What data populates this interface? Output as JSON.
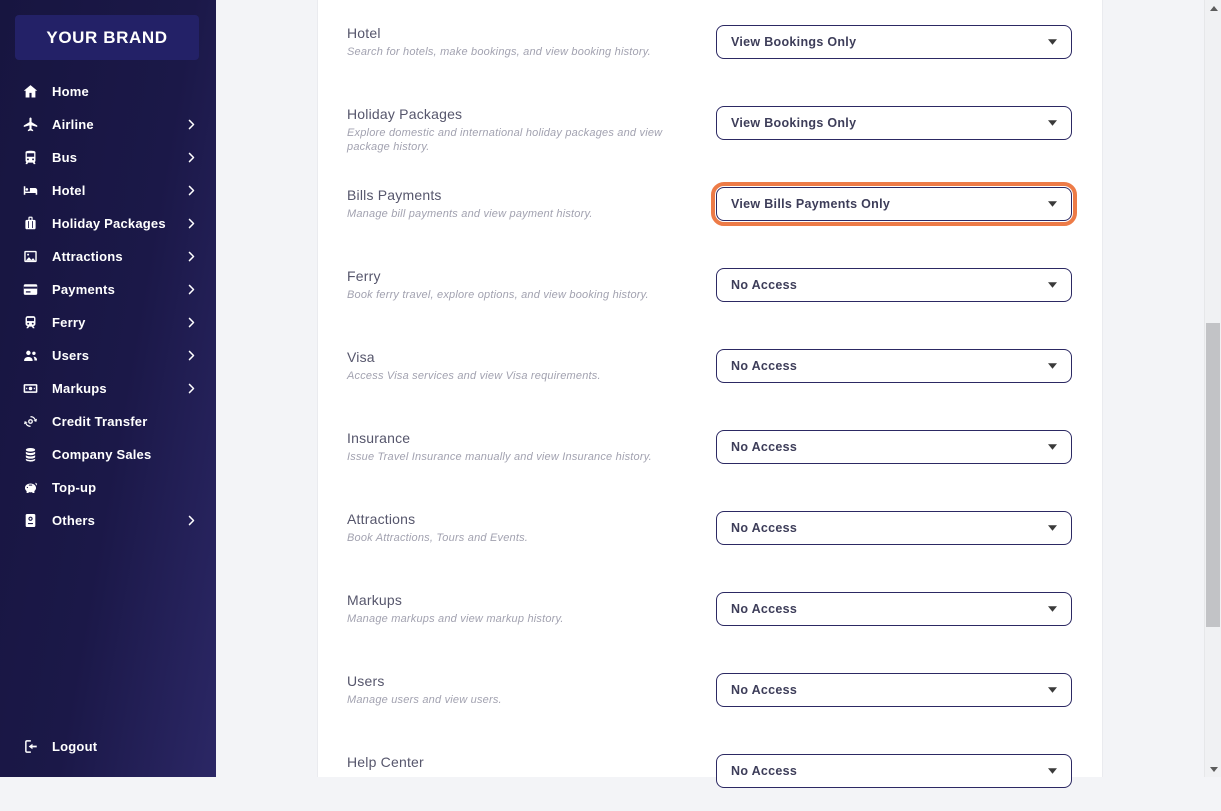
{
  "brand": {
    "name": "YOUR BRAND"
  },
  "sidebar": {
    "items": [
      {
        "label": "Home",
        "icon": "home",
        "chevron": false
      },
      {
        "label": "Airline",
        "icon": "airline",
        "chevron": true
      },
      {
        "label": "Bus",
        "icon": "bus",
        "chevron": true
      },
      {
        "label": "Hotel",
        "icon": "hotel",
        "chevron": true
      },
      {
        "label": "Holiday Packages",
        "icon": "holiday-packages",
        "chevron": true
      },
      {
        "label": "Attractions",
        "icon": "attractions",
        "chevron": true
      },
      {
        "label": "Payments",
        "icon": "payments",
        "chevron": true
      },
      {
        "label": "Ferry",
        "icon": "ferry",
        "chevron": true
      },
      {
        "label": "Users",
        "icon": "users",
        "chevron": true
      },
      {
        "label": "Markups",
        "icon": "markups",
        "chevron": true
      },
      {
        "label": "Credit Transfer",
        "icon": "credit-transfer",
        "chevron": false
      },
      {
        "label": "Company Sales",
        "icon": "company-sales",
        "chevron": false
      },
      {
        "label": "Top-up",
        "icon": "top-up",
        "chevron": false
      },
      {
        "label": "Others",
        "icon": "others",
        "chevron": true
      }
    ],
    "logout": {
      "label": "Logout",
      "icon": "logout"
    }
  },
  "permissions": {
    "highlight_color": "#ed7b47",
    "rows": [
      {
        "title": "Hotel",
        "description": "Search for hotels, make bookings, and view booking history.",
        "value": "View Bookings Only",
        "highlighted": false
      },
      {
        "title": "Holiday Packages",
        "description": "Explore domestic and international holiday packages and view package history.",
        "value": "View Bookings Only",
        "highlighted": false
      },
      {
        "title": "Bills Payments",
        "description": "Manage bill payments and view payment history.",
        "value": "View Bills Payments Only",
        "highlighted": true
      },
      {
        "title": "Ferry",
        "description": "Book ferry travel, explore options, and view booking history.",
        "value": "No Access",
        "highlighted": false
      },
      {
        "title": "Visa",
        "description": "Access Visa services and view Visa requirements.",
        "value": "No Access",
        "highlighted": false
      },
      {
        "title": "Insurance",
        "description": "Issue Travel Insurance manually and view Insurance history.",
        "value": "No Access",
        "highlighted": false
      },
      {
        "title": "Attractions",
        "description": "Book Attractions, Tours and Events.",
        "value": "No Access",
        "highlighted": false
      },
      {
        "title": "Markups",
        "description": "Manage markups and view markup history.",
        "value": "No Access",
        "highlighted": false
      },
      {
        "title": "Users",
        "description": "Manage users and view users.",
        "value": "No Access",
        "highlighted": false
      },
      {
        "title": "Help Center",
        "description": "",
        "value": "No Access",
        "highlighted": false
      }
    ]
  }
}
